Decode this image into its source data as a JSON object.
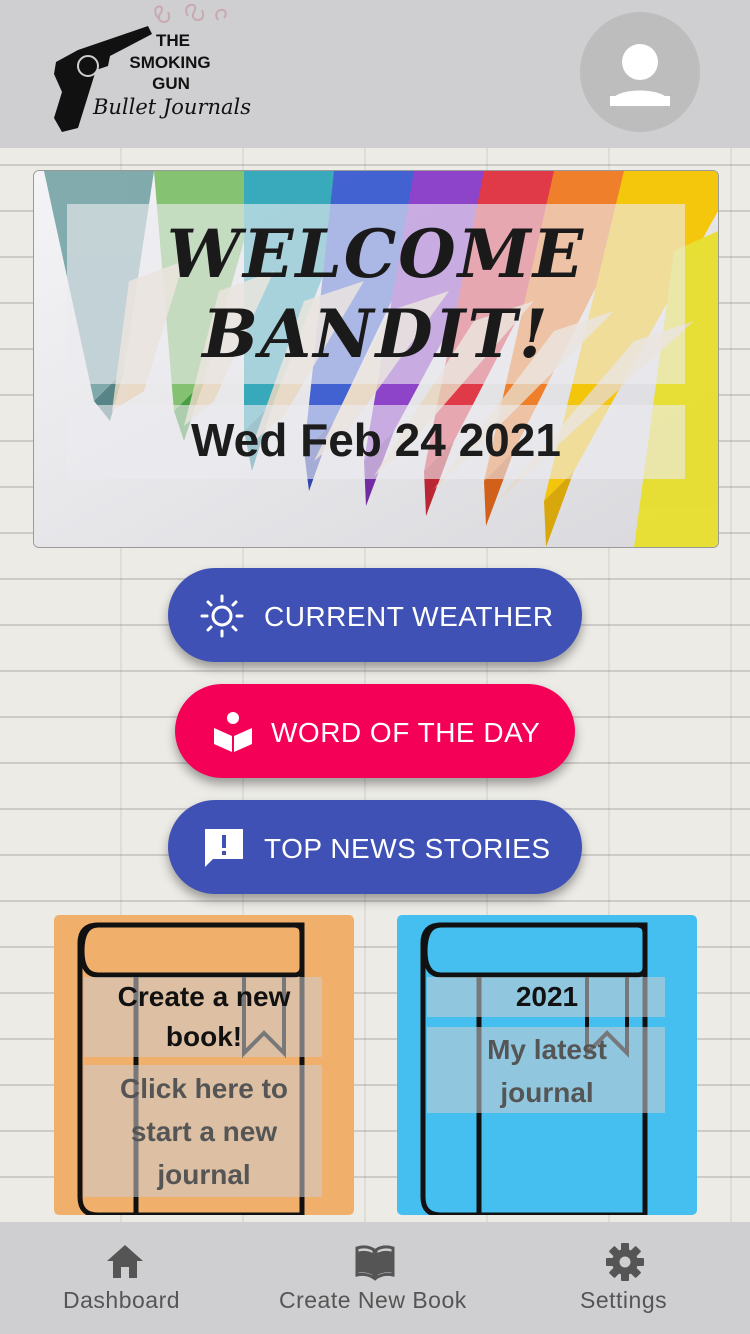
{
  "header": {
    "logo_line1": "THE",
    "logo_line2": "SMOKING",
    "logo_line3": "GUN",
    "logo_line4": "Bullet Journals"
  },
  "welcome": {
    "title_line1": "WELCOME",
    "title_line2": "BANDIT!",
    "date": "Wed Feb 24 2021"
  },
  "actions": {
    "weather_label": "CURRENT WEATHER",
    "word_label": "WORD OF THE DAY",
    "news_label": "TOP NEWS STORIES"
  },
  "books": [
    {
      "title": "Create a new book!",
      "subtitle": "Click here to start a new journal"
    },
    {
      "title": "2021",
      "subtitle": "My latest journal"
    }
  ],
  "nav": {
    "items": [
      {
        "label": "Dashboard",
        "icon": "home-icon"
      },
      {
        "label": "Create New Book",
        "icon": "book-open-icon"
      },
      {
        "label": "Settings",
        "icon": "gear-icon"
      }
    ]
  },
  "colors": {
    "blue_button": "#3f51b5",
    "pink_button": "#f50057",
    "orange_card": "#f0b06c",
    "blue_card": "#45bef0"
  }
}
